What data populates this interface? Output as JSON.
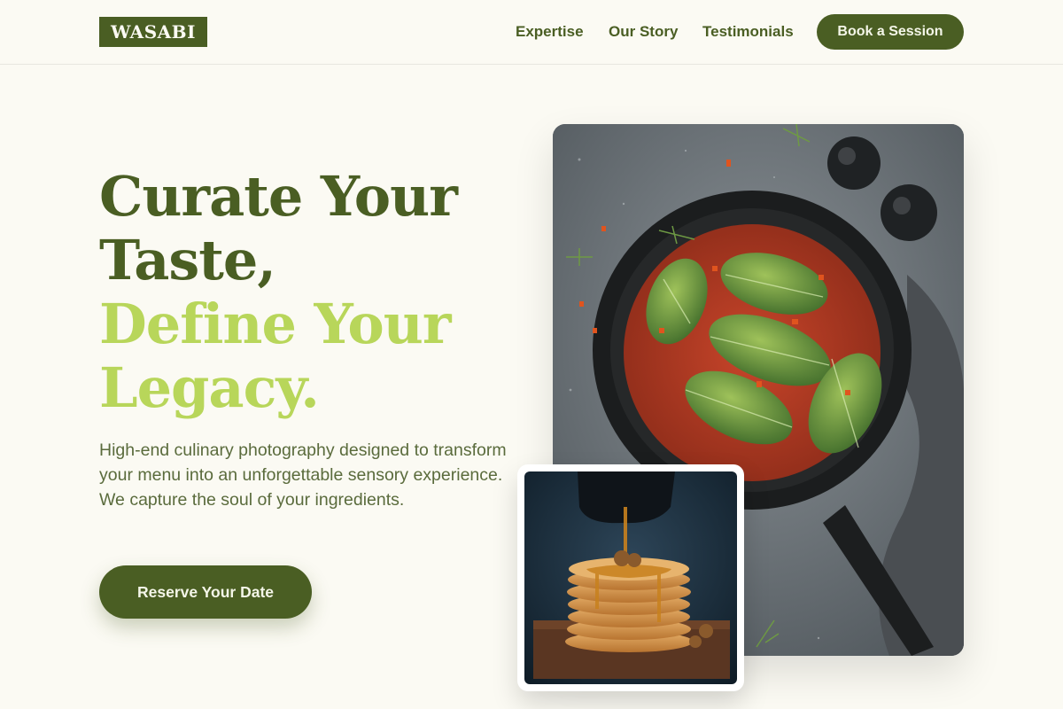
{
  "brand": {
    "logo_text": "WASABI"
  },
  "nav": {
    "items": [
      {
        "label": "Expertise"
      },
      {
        "label": "Our Story"
      },
      {
        "label": "Testimonials"
      }
    ],
    "cta_label": "Book a Session"
  },
  "hero": {
    "headline_lines": [
      {
        "text": "Curate Your",
        "tone": "dark"
      },
      {
        "text": "Taste,",
        "tone": "dark"
      },
      {
        "text": "Define Your",
        "tone": "light"
      },
      {
        "text": "Legacy.",
        "tone": "light"
      }
    ],
    "description": "High-end culinary photography designed to transform your menu into an unforgettable sensory experience. We capture the soul of your ingredients.",
    "cta_label": "Reserve Your Date"
  },
  "images": {
    "main": {
      "subject": "cabbage-rolls-in-skillet-photo"
    },
    "card": {
      "subject": "pancake-stack-syrup-photo"
    }
  },
  "colors": {
    "brand_dark": "#4a5e23",
    "brand_light": "#b8d65a",
    "background": "#fbfaf3"
  }
}
